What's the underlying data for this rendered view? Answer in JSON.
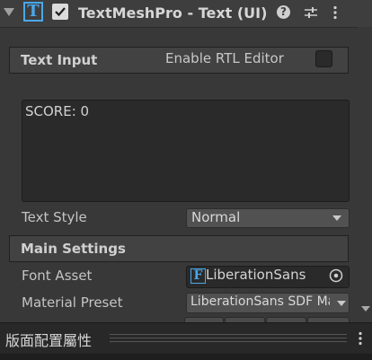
{
  "component": {
    "icon": "T",
    "enabled": true,
    "title": "TextMeshPro - Text (UI)",
    "help_icon": "question-circle-icon",
    "presets_icon": "sliders-icon",
    "menu_icon": "kebab-menu-icon"
  },
  "text_input": {
    "section_title": "Text Input",
    "rtl_label": "Enable RTL Editor",
    "rtl_enabled": false,
    "value": "SCORE: 0"
  },
  "text_style": {
    "label": "Text Style",
    "value": "Normal"
  },
  "main_settings": {
    "section_title": "Main Settings",
    "font_asset": {
      "label": "Font Asset",
      "icon": "F",
      "value": "LiberationSans"
    },
    "material_preset": {
      "label": "Material Preset",
      "value": "LiberationSans SDF Material"
    }
  },
  "bottom_panel": {
    "title": "版面配置屬性"
  },
  "colors": {
    "accent": "#4aa8e8",
    "panel": "#383838",
    "header": "#3e3e3e",
    "field": "#2a2a2a"
  }
}
